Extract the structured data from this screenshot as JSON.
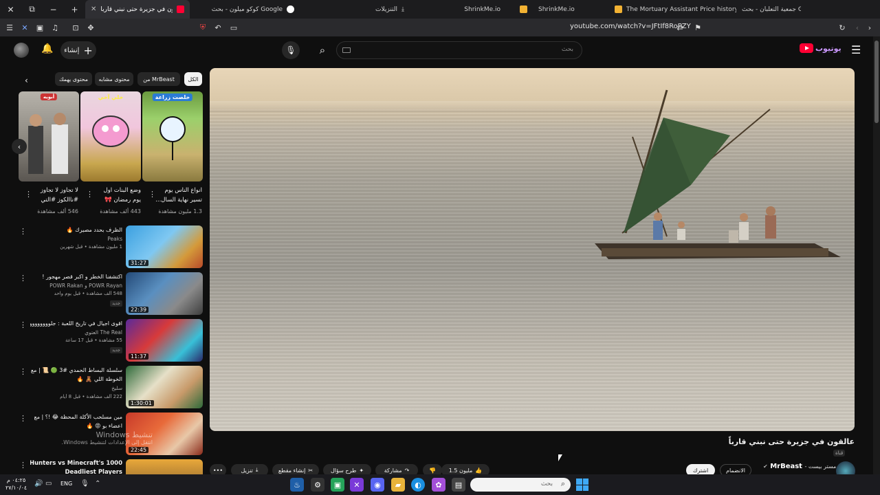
{
  "browser": {
    "tabs": [
      {
        "label": "عاقلون في جزيرة حتى نبني قاربا",
        "active": true,
        "favicon_color": "#ff0033"
      },
      {
        "label": "كوكو ميلون - بحث Google",
        "favicon_color": "#ffffff"
      },
      {
        "label": "التنزيلات",
        "favicon_color": "#cfcfcf"
      },
      {
        "label": "ShrinkMe.io",
        "favicon_color": "#f2b233"
      },
      {
        "label": "ShrinkMe.io",
        "favicon_color": "#f2b233"
      },
      {
        "label": "The Mortuary Assistant Price history",
        "favicon_color": "#dddddd"
      },
      {
        "label": "جمعية التعلبان - بحث Google",
        "favicon_color": "#ffffff"
      }
    ],
    "url": "youtube.com/watch?v=JFtIf8RoPZY",
    "ext_badge": "99+"
  },
  "header": {
    "search_placeholder": "بحث",
    "create_label": "إنشاء"
  },
  "video": {
    "title": "عالقون في جزيرة حتى نبني قارباً",
    "channel_stamp": "قناة",
    "channel_name": "MrBeast",
    "channel_suffix": "مستر بيست -",
    "subscribe_label": "اشترك",
    "join_label": "الانضمام",
    "likes": "1.5 مليون",
    "share_label": "مشاركة",
    "ask_label": "طرح سؤال",
    "clip_label": "إنشاء مقطع",
    "download_label": "تنزيل",
    "more_label": "•••"
  },
  "chips": {
    "all": "الكل",
    "mrbeast": "من MrBeast",
    "related": "محتوى مشابه",
    "interest": "محتوى يهمك"
  },
  "shorts": [
    {
      "badge": "خلصت زراعة",
      "title_line1": "انواع الناس يوم",
      "title_line2": "تسير نهاية السال...",
      "views": "1.3 مليون مشاهدة"
    },
    {
      "badge": "خلي آخي",
      "title_line1": "وضع البنات اول",
      "title_line2": "يوم رمضان 🎀",
      "views": "443 ألف مشاهدة"
    },
    {
      "badge": "أبويه",
      "title_line1": "لا تجاوز لا تجاوز",
      "title_line2": "#ناالكوز #التي",
      "views": "546 ألف مشاهدة"
    }
  ],
  "videos": [
    {
      "title1": "الظرف بحدد مصيرك 🔥",
      "title2": "",
      "channel": "Peaks",
      "meta": "1 مليون مشاهدة • قبل شهرين",
      "duration": "31:27",
      "isnew": false
    },
    {
      "title1": "اكتشفنا الخطر و اكبر قصر مهجور !",
      "title2": "",
      "channel": "POWR Rayan و POWR Rakan",
      "meta": "548 ألف مشاهدة • قبل يوم واحد",
      "duration": "22:39",
      "isnew": true
    },
    {
      "title1": "اقوى اجيال في تاريخ اللعبة : جلووووووووووو",
      "title2": "",
      "channel": "The Real العتوي",
      "meta": "55 مشاهدة • قبل 17 ساعة",
      "duration": "11:37",
      "isnew": true
    },
    {
      "title1": "سلسلة البساط الحمدي #3 🟢 📜 | مع كلي",
      "title2": "الخوطة اللي 🧸 🔥",
      "channel": "سليخ",
      "meta": "222 ألف مشاهدة • قبل 8 أيام",
      "duration": "1:30:01",
      "isnew": false
    },
    {
      "title1": "مين مسلحب الأكلة المحظة 😂 !؟ | مع",
      "title2": "اعضاء بو 😡 🔥",
      "channel": "",
      "meta": "",
      "duration": "22:45",
      "isnew": false
    },
    {
      "title1": "1000 Hunters vs Minecraft's",
      "title2": "Deadliest Players",
      "channel": "",
      "meta": "",
      "duration": "",
      "isnew": false
    }
  ],
  "watermark": {
    "line1": "تنشيط Windows",
    "line2": "انتقل إلى الإعدادات لتنشيط Windows."
  },
  "taskbar": {
    "time": "٠٤:٢٥ م",
    "date": "٢٧/١٠/٠٤",
    "lang": "ENG",
    "search_placeholder": "بحث"
  }
}
